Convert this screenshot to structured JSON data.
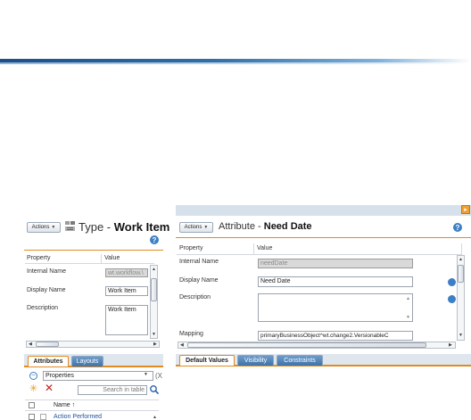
{
  "left_panel": {
    "actions_label": "Actions",
    "title_prefix": "Type - ",
    "title_name": "Work Item",
    "columns": {
      "property": "Property",
      "value": "Value"
    },
    "rows": [
      {
        "label": "Internal Name",
        "value": "wt.workflow.\\"
      },
      {
        "label": "Display Name",
        "value": "Work Item"
      },
      {
        "label": "Description",
        "value": "Work Item"
      }
    ],
    "tabs": [
      {
        "label": "Attributes",
        "active": true
      },
      {
        "label": "Layouts",
        "active": false
      }
    ],
    "filter_value": "Properties",
    "filter_extra": "(X",
    "search_placeholder": "Search in table",
    "name_column": "Name",
    "sort_arrow": "↑",
    "first_item": "Action Performed"
  },
  "right_panel": {
    "actions_label": "Actions",
    "title_prefix": "Attribute - ",
    "title_name": "Need Date",
    "columns": {
      "property": "Property",
      "value": "Value"
    },
    "rows": [
      {
        "label": "Internal Name",
        "value": "needDate",
        "disabled": true
      },
      {
        "label": "Display Name",
        "value": "Need Date"
      },
      {
        "label": "Description",
        "value": ""
      },
      {
        "label": "Mapping",
        "value": "primaryBusinessObject^wt.change2.VersionableC"
      }
    ],
    "tabs": [
      {
        "label": "Default Values",
        "active": true
      },
      {
        "label": "Visibility",
        "active": false
      },
      {
        "label": "Constraints",
        "active": false
      }
    ]
  },
  "icons": {
    "help": "help-icon",
    "type": "type-icon",
    "collapse": "collapse-icon",
    "add": "add-icon",
    "delete": "delete-icon",
    "search": "search-icon",
    "expand_panel": "expand-panel-icon",
    "info": "info-icon"
  },
  "colors": {
    "accent": "#e08a20",
    "brand_blue": "#2f6ea7",
    "tab_blue": "#4f82b6"
  }
}
